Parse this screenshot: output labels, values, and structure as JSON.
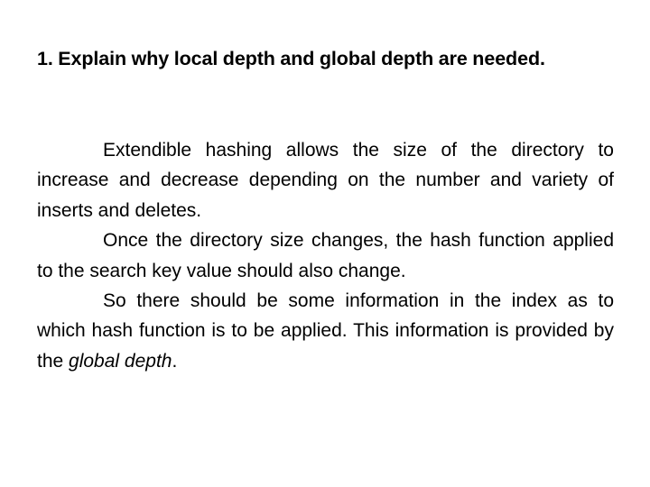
{
  "slide": {
    "background_color": "#ffffff",
    "text_color": "#000000",
    "heading": "1. Explain why local depth and global depth are needed.",
    "paragraphs": [
      {
        "id": "para-extendible-hashing",
        "text": "Extendible hashing allows the size of the directory to increase and decrease depending on the number and variety of inserts and deletes."
      },
      {
        "id": "para-hash-function-change",
        "text": "Once the directory size changes, the hash function applied to the search key value should also change."
      },
      {
        "id": "para-global-depth",
        "lead": "So there should be some information in the index as to which hash function is to be applied. This information is provided by the ",
        "emphasis": "global depth",
        "tail": "."
      }
    ]
  }
}
